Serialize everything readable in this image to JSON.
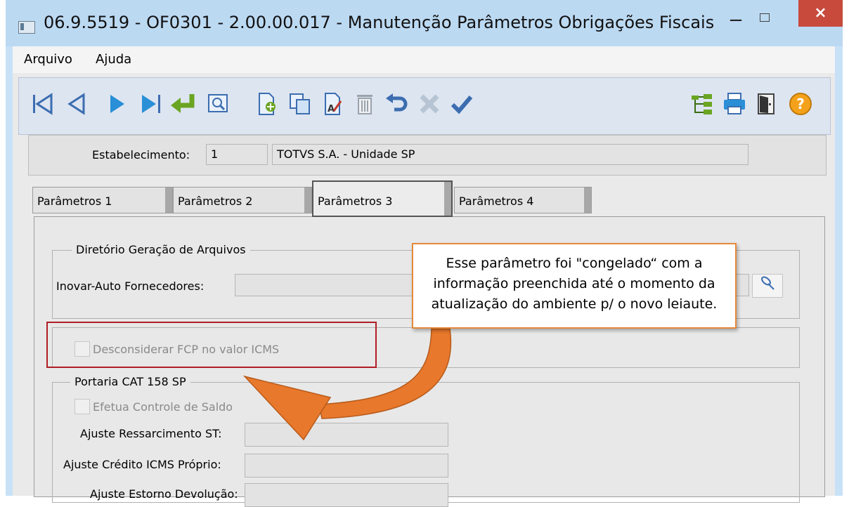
{
  "window": {
    "title": "06.9.5519 - OF0301 - 2.00.00.017 - Manutenção Parâmetros Obrigações Fiscais",
    "minimize": "−",
    "close": "×"
  },
  "menu": {
    "arquivo": "Arquivo",
    "ajuda": "Ajuda"
  },
  "toolbar": {
    "icons": [
      "first-record-icon",
      "previous-record-icon",
      "next-record-icon",
      "last-record-icon",
      "goto-icon",
      "search-icon",
      "new-icon",
      "copy-icon",
      "edit-icon",
      "delete-icon",
      "undo-icon",
      "cancel-icon",
      "confirm-icon",
      "tree-icon",
      "print-icon",
      "exit-icon",
      "help-icon"
    ],
    "help_label": "?"
  },
  "estabelecimento": {
    "label": "Estabelecimento:",
    "code": "1",
    "name": "TOTVS S.A. - Unidade SP"
  },
  "tabs": [
    {
      "label": "Parâmetros 1"
    },
    {
      "label": "Parâmetros 2"
    },
    {
      "label": "Parâmetros 3"
    },
    {
      "label": "Parâmetros 4"
    }
  ],
  "active_tab": "Parâmetros 3",
  "diretorio": {
    "legend": "Diretório Geração de Arquivos",
    "inovar_label": "Inovar-Auto Fornecedores:",
    "inovar_value": ""
  },
  "fcp": {
    "label": "Desconsiderar FCP no valor ICMS",
    "checked": false
  },
  "portaria": {
    "legend": "Portaria CAT 158 SP",
    "controle_label": "Efetua Controle de Saldo",
    "ressarcimento_label": "Ajuste Ressarcimento ST:",
    "credito_label": "Ajuste Crédito ICMS Próprio:",
    "estorno_label": "Ajuste Estorno Devolução:"
  },
  "annotation": {
    "line1": "Esse parâmetro foi \"congelado“ com a",
    "line2": "informação preenchida até o momento da",
    "line3": "atualização do ambiente p/ o novo leiaute."
  },
  "colors": {
    "title_bar": "#bcd9f2",
    "close": "#c74a3d",
    "highlight_box": "#b01d25",
    "callout_border": "#e58a3a",
    "arrow": "#e8782b"
  }
}
